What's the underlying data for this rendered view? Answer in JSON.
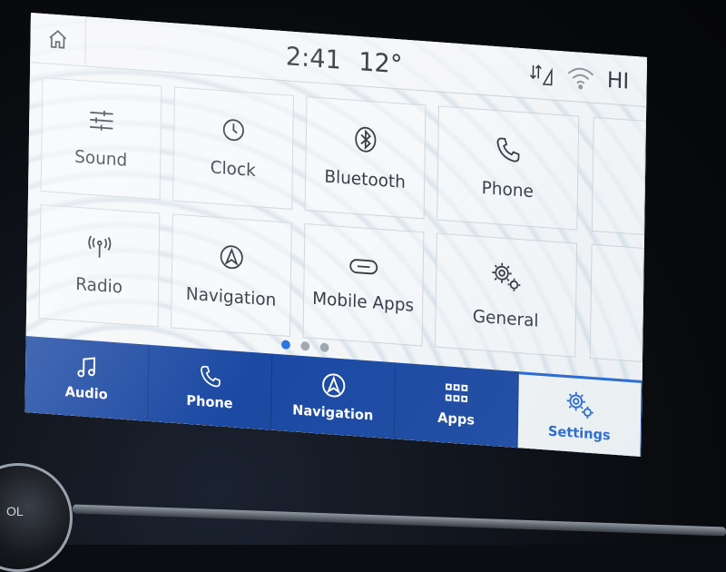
{
  "status": {
    "time": "2:41",
    "temperature": "12°",
    "user_initials": "HI"
  },
  "tiles": [
    {
      "label": "Sound",
      "icon": "sliders-icon"
    },
    {
      "label": "Clock",
      "icon": "clock-icon"
    },
    {
      "label": "Bluetooth",
      "icon": "bluetooth-icon"
    },
    {
      "label": "Phone",
      "icon": "phone-icon"
    },
    {
      "label": "Radio",
      "icon": "radio-antenna-icon"
    },
    {
      "label": "Navigation",
      "icon": "navigation-arrow-icon"
    },
    {
      "label": "Mobile Apps",
      "icon": "link-icon"
    },
    {
      "label": "General",
      "icon": "gears-icon"
    }
  ],
  "pager": {
    "pages": 3,
    "current": 1
  },
  "bottom_nav": [
    {
      "label": "Audio",
      "icon": "music-note-icon",
      "active": false
    },
    {
      "label": "Phone",
      "icon": "phone-icon",
      "active": false
    },
    {
      "label": "Navigation",
      "icon": "navigation-arrow-icon",
      "active": false
    },
    {
      "label": "Apps",
      "icon": "apps-grid-icon",
      "active": false
    },
    {
      "label": "Settings",
      "icon": "gears-icon",
      "active": true
    }
  ],
  "knob_label": "OL",
  "colors": {
    "accent": "#1b5fd0",
    "nav_bar": "#0f3f9e",
    "text": "#2c333b"
  }
}
